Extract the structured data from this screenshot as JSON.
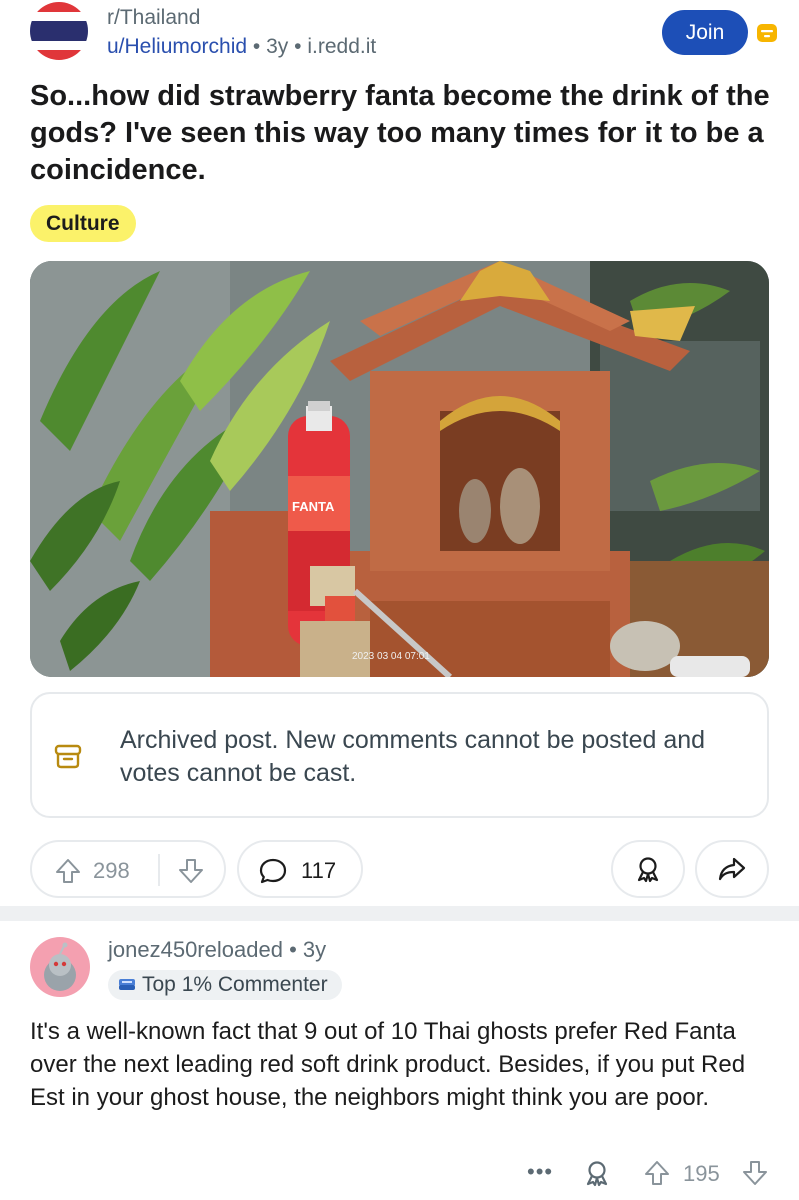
{
  "post": {
    "subreddit": "r/Thailand",
    "author": "u/Heliumorchid",
    "age": "3y",
    "domain": "i.redd.it",
    "separator": "•",
    "join_label": "Join",
    "title": "So...how did strawberry fanta become the drink of the gods? I've seen this way too many times for it to be a coincidence.",
    "flair": "Culture",
    "image": {
      "bottle_label": "FANTA",
      "timestamp": "2023 03 04 07:01"
    },
    "archived_notice": "Archived post. New comments cannot be posted and votes cannot be cast.",
    "score": "298",
    "comment_count": "117"
  },
  "comment": {
    "author": "jonez450reloaded",
    "separator": "•",
    "age": "3y",
    "badge": "Top 1% Commenter",
    "body": "It's a well-known fact that 9 out of 10 Thai ghosts prefer Red Fanta over the next leading red soft drink product. Besides, if you put Red Est in your ghost house, the neighbors might think you are poor.",
    "more_label": "•••",
    "score": "195"
  },
  "colors": {
    "join_blue": "#1d4fb7",
    "flair_yellow": "#fbf26a",
    "link_blue": "#2a4fae",
    "meta_gray": "#5c6a73",
    "archive_gold": "#b88a10"
  },
  "icons": {
    "subreddit_avatar": "thailand-flag-icon",
    "archive_badge": "archive-box-icon",
    "upvote": "arrow-up-outline-icon",
    "downvote": "arrow-down-outline-icon",
    "comments": "speech-bubble-icon",
    "award": "award-ribbon-icon",
    "share": "share-arrow-icon",
    "commenter_badge": "medal-icon",
    "comment_avatar": "snoo-avatar-icon"
  }
}
